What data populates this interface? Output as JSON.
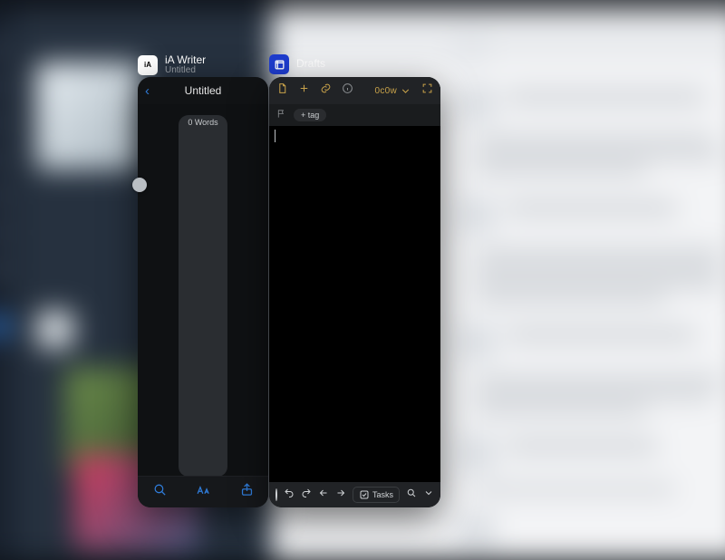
{
  "apps": {
    "ia": {
      "name": "iA Writer",
      "subtitle": "Untitled"
    },
    "drafts": {
      "name": "Drafts"
    }
  },
  "ia": {
    "title": "Untitled",
    "word_badge": "0 Words"
  },
  "drafts": {
    "counter": "0c0w",
    "tag_add": "+ tag",
    "tasks_label": "Tasks"
  }
}
